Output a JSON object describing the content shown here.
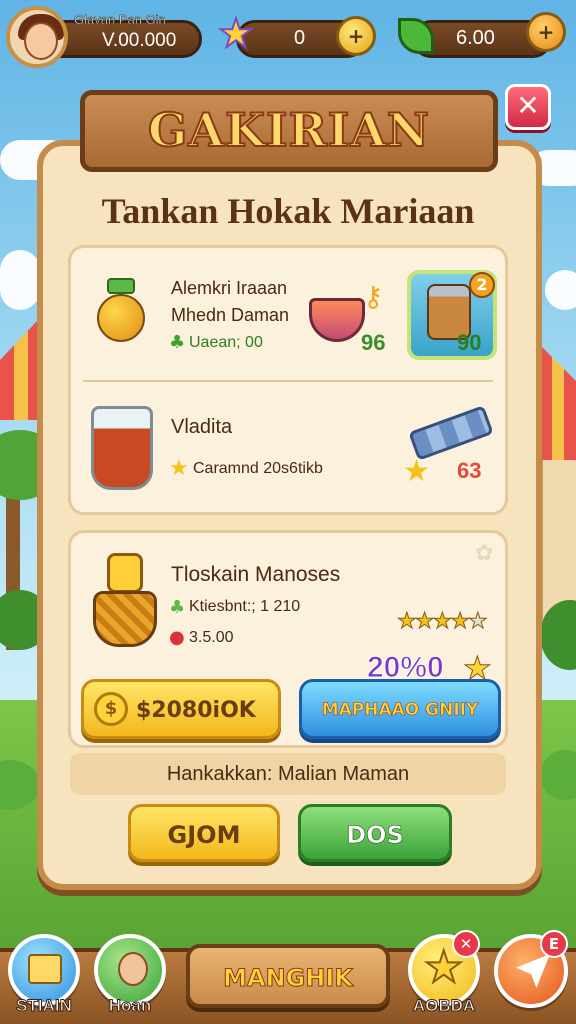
{
  "header": {
    "player_name": "Glavan Pan Gin",
    "player_balance": "V.00.000",
    "gems_value": "0",
    "leaf_value": "6.00"
  },
  "dialog": {
    "title": "GAKIRIAN",
    "subtitle": "Tankan Hokak Mariaan",
    "close_label": "✕"
  },
  "card1": {
    "item1_name_line1": "Alemkri Iraaan",
    "item1_name_line2": "Mhedn Daman",
    "item1_stats": "Uaean; 00",
    "item2_value": "96",
    "item3_badge": "2",
    "item3_value": "90",
    "item4_name": "Vladita",
    "item4_stats": "Caramnd 20s6tikb",
    "item5_value": "63"
  },
  "card2": {
    "name": "Tloskain Manoses",
    "stat1": "Ktiesbnt:; 1 210",
    "stat2": "3.5.00",
    "rating": 4,
    "discount": "20%0",
    "price_button": "$2080iOK",
    "buy_button": "MAPHAAO GNIIY"
  },
  "footer_note": "Hankakkan: Malian Maman",
  "actions": {
    "left_button": "GJOM",
    "right_button": "DOS"
  },
  "dock": {
    "left1_label": "STIAIN",
    "left2_label": "Hoan",
    "center_label": "MANGHIK",
    "right1_label": "AOBDA",
    "right1_badge": "✕",
    "right2_badge": "E"
  }
}
